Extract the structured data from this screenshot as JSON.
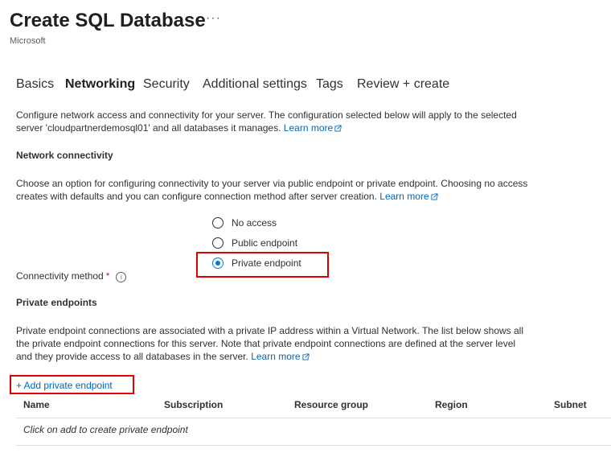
{
  "header": {
    "title": "Create SQL Database",
    "more": "···",
    "subtitle": "Microsoft"
  },
  "tabs": [
    {
      "label": "Basics"
    },
    {
      "label": "Networking"
    },
    {
      "label": "Security"
    },
    {
      "label": "Additional settings"
    },
    {
      "label": "Tags"
    },
    {
      "label": "Review + create"
    }
  ],
  "intro": {
    "line1": "Configure network access and connectivity for your server. The configuration selected below will apply to the selected",
    "line2": "server 'cloudpartnerdemosql01' and all databases it manages.",
    "learn_more": "Learn more"
  },
  "network_connectivity": {
    "heading": "Network connectivity",
    "desc_line1": "Choose an option for configuring connectivity to your server via public endpoint or private endpoint. Choosing no access",
    "desc_line2": "creates with defaults and you can configure connection method after server creation.",
    "learn_more": "Learn more",
    "field_label": "Connectivity method",
    "required_mark": "*",
    "info_icon": "i",
    "options": [
      {
        "label": "No access",
        "selected": false
      },
      {
        "label": "Public endpoint",
        "selected": false
      },
      {
        "label": "Private endpoint",
        "selected": true
      }
    ]
  },
  "private_endpoints": {
    "heading": "Private endpoints",
    "desc_line1": "Private endpoint connections are associated with a private IP address within a Virtual Network. The list below shows all",
    "desc_line2": "the private endpoint connections for this server. Note that private endpoint connections are defined at the server level",
    "desc_line3": "and they provide access to all databases in the server.",
    "learn_more": "Learn more",
    "add_button": "+ Add private endpoint",
    "columns": [
      "Name",
      "Subscription",
      "Resource group",
      "Region",
      "Subnet"
    ],
    "empty_text": "Click on add to create private endpoint"
  },
  "colors": {
    "accent": "#0078d4",
    "link": "#0067b8",
    "highlight": "#e00000"
  }
}
